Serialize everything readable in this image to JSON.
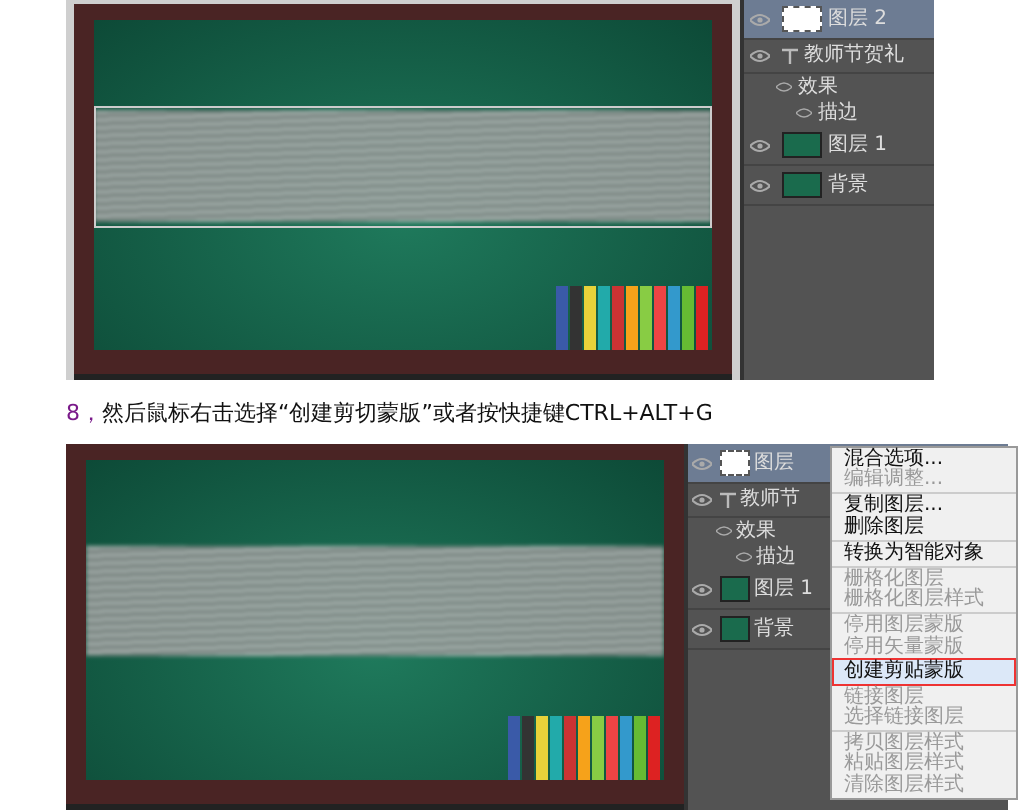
{
  "screenshots": [
    {
      "layers": [
        {
          "name": "图层 2",
          "kind": "image",
          "selected": true
        },
        {
          "name": "教师节贺礼",
          "kind": "text",
          "selected": false,
          "children": [
            {
              "name": "效果",
              "kind": "effect",
              "selected": false,
              "children": [
                {
                  "name": "描边",
                  "kind": "effect",
                  "selected": false
                }
              ]
            }
          ]
        },
        {
          "name": "图层 1",
          "kind": "image",
          "selected": false
        },
        {
          "name": "背景",
          "kind": "image",
          "selected": false
        }
      ]
    },
    {
      "layers": [
        {
          "name": "图层",
          "kind": "image",
          "selected": true
        },
        {
          "name": "教师节",
          "kind": "text",
          "selected": false,
          "children": [
            {
              "name": "效果",
              "kind": "effect",
              "selected": false,
              "children": [
                {
                  "name": "描边",
                  "kind": "effect",
                  "selected": false
                }
              ]
            }
          ]
        },
        {
          "name": "图层 1",
          "kind": "image",
          "selected": false
        },
        {
          "name": "背景",
          "kind": "image",
          "selected": false
        }
      ],
      "menu": [
        {
          "label": "混合选项...",
          "disabled": false,
          "selected": false,
          "separator_after": false
        },
        {
          "label": "编辑调整...",
          "disabled": true,
          "selected": false,
          "separator_after": true
        },
        {
          "label": "复制图层...",
          "disabled": false,
          "selected": false,
          "separator_after": false
        },
        {
          "label": "删除图层",
          "disabled": false,
          "selected": false,
          "separator_after": true
        },
        {
          "label": "转换为智能对象",
          "disabled": false,
          "selected": false,
          "separator_after": true
        },
        {
          "label": "栅格化图层",
          "disabled": true,
          "selected": false,
          "separator_after": false
        },
        {
          "label": "栅格化图层样式",
          "disabled": true,
          "selected": false,
          "separator_after": true
        },
        {
          "label": "停用图层蒙版",
          "disabled": true,
          "selected": false,
          "separator_after": false
        },
        {
          "label": "停用矢量蒙版",
          "disabled": true,
          "selected": false,
          "separator_after": false
        },
        {
          "label": "创建剪贴蒙版",
          "disabled": false,
          "selected": true,
          "separator_after": true
        },
        {
          "label": "链接图层",
          "disabled": true,
          "selected": false,
          "separator_after": false
        },
        {
          "label": "选择链接图层",
          "disabled": true,
          "selected": false,
          "separator_after": true
        },
        {
          "label": "拷贝图层样式",
          "disabled": true,
          "selected": false,
          "separator_after": false
        },
        {
          "label": "粘贴图层样式",
          "disabled": true,
          "selected": false,
          "separator_after": false
        },
        {
          "label": "清除图层样式",
          "disabled": true,
          "selected": false,
          "separator_after": false
        }
      ]
    }
  ],
  "step": {
    "number": "8，",
    "text": "然后鼠标右击选择“创建剪切蒙版”或者按快捷键CTRL+ALT+G"
  }
}
